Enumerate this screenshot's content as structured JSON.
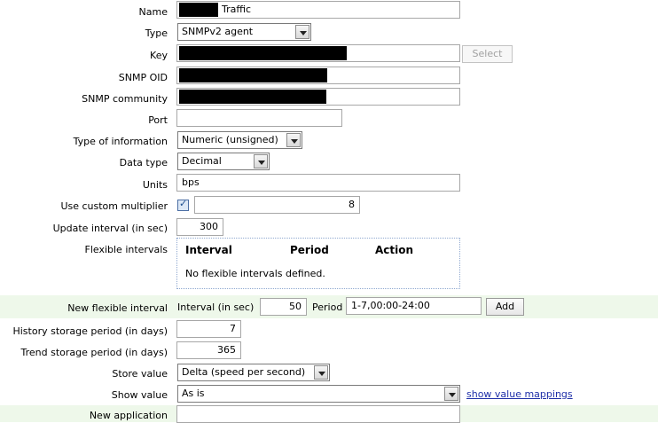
{
  "form": {
    "name": {
      "label": "Name",
      "value": "Traffic"
    },
    "type": {
      "label": "Type",
      "value": "SNMPv2 agent"
    },
    "key": {
      "label": "Key",
      "button": "Select"
    },
    "snmp_oid": {
      "label": "SNMP OID"
    },
    "snmp_community": {
      "label": "SNMP community"
    },
    "port": {
      "label": "Port",
      "value": ""
    },
    "type_of_information": {
      "label": "Type of information",
      "value": "Numeric (unsigned)"
    },
    "data_type": {
      "label": "Data type",
      "value": "Decimal"
    },
    "units": {
      "label": "Units",
      "value": "bps"
    },
    "custom_multiplier": {
      "label": "Use custom multiplier",
      "checked": true,
      "value": "8"
    },
    "update_interval": {
      "label": "Update interval (in sec)",
      "value": "300"
    },
    "flexible_intervals": {
      "label": "Flexible intervals",
      "headers": [
        "Interval",
        "Period",
        "Action"
      ],
      "empty_text": "No flexible intervals defined."
    },
    "new_flexible_interval": {
      "label": "New flexible interval",
      "interval_label": "Interval (in sec)",
      "interval_value": "50",
      "period_label": "Period",
      "period_value": "1-7,00:00-24:00",
      "add_button": "Add"
    },
    "history_storage": {
      "label": "History storage period (in days)",
      "value": "7"
    },
    "trend_storage": {
      "label": "Trend storage period (in days)",
      "value": "365"
    },
    "store_value": {
      "label": "Store value",
      "value": "Delta (speed per second)"
    },
    "show_value": {
      "label": "Show value",
      "value": "As is",
      "link": "show value mappings"
    },
    "new_application": {
      "label": "New application",
      "value": ""
    }
  }
}
